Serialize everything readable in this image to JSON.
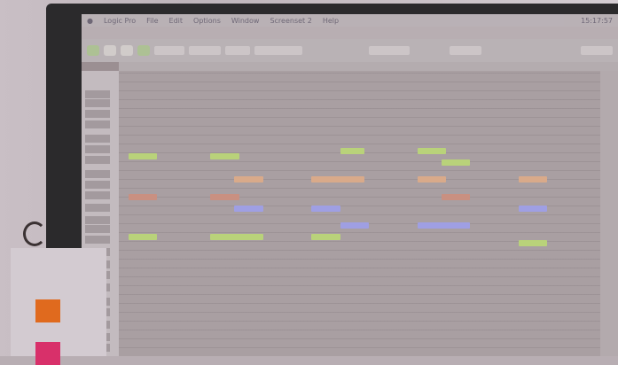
{
  "menubar": {
    "app": "Logic Pro",
    "items": [
      "File",
      "Edit",
      "Options",
      "Window",
      "Screenset 2",
      "Help"
    ],
    "clock": "15:17:57"
  },
  "colors": {
    "note_green": "#b9d27a",
    "note_orange": "#d9aa8a",
    "note_red": "#c99081",
    "note_blue": "#9f9fe3",
    "swatch_orange": "#e06a1e",
    "swatch_pink": "#d8306a"
  },
  "notes": [
    {
      "color": "green",
      "start": 0.02,
      "len": 0.06,
      "pitch": 66
    },
    {
      "color": "red",
      "start": 0.02,
      "len": 0.06,
      "pitch": 59
    },
    {
      "color": "green",
      "start": 0.02,
      "len": 0.06,
      "pitch": 52
    },
    {
      "color": "green",
      "start": 0.19,
      "len": 0.06,
      "pitch": 66
    },
    {
      "color": "orange",
      "start": 0.24,
      "len": 0.06,
      "pitch": 62
    },
    {
      "color": "red",
      "start": 0.19,
      "len": 0.06,
      "pitch": 59
    },
    {
      "color": "blue",
      "start": 0.24,
      "len": 0.06,
      "pitch": 57
    },
    {
      "color": "green",
      "start": 0.19,
      "len": 0.11,
      "pitch": 52
    },
    {
      "color": "orange",
      "start": 0.4,
      "len": 0.11,
      "pitch": 62
    },
    {
      "color": "green",
      "start": 0.46,
      "len": 0.05,
      "pitch": 67
    },
    {
      "color": "blue",
      "start": 0.4,
      "len": 0.06,
      "pitch": 57
    },
    {
      "color": "blue",
      "start": 0.46,
      "len": 0.06,
      "pitch": 54
    },
    {
      "color": "green",
      "start": 0.4,
      "len": 0.06,
      "pitch": 52
    },
    {
      "color": "green",
      "start": 0.62,
      "len": 0.06,
      "pitch": 67
    },
    {
      "color": "green",
      "start": 0.67,
      "len": 0.06,
      "pitch": 65
    },
    {
      "color": "orange",
      "start": 0.62,
      "len": 0.06,
      "pitch": 62
    },
    {
      "color": "red",
      "start": 0.67,
      "len": 0.06,
      "pitch": 59
    },
    {
      "color": "blue",
      "start": 0.62,
      "len": 0.11,
      "pitch": 54
    },
    {
      "color": "orange",
      "start": 0.83,
      "len": 0.06,
      "pitch": 62
    },
    {
      "color": "blue",
      "start": 0.83,
      "len": 0.06,
      "pitch": 57
    },
    {
      "color": "green",
      "start": 0.83,
      "len": 0.06,
      "pitch": 51
    }
  ]
}
